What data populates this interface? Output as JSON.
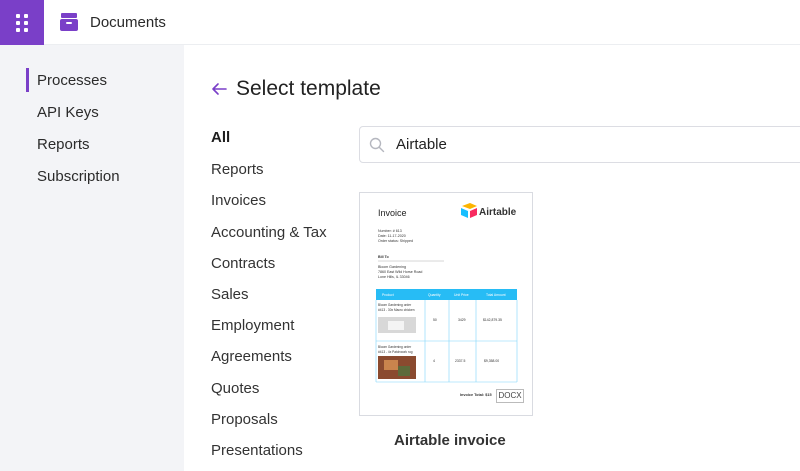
{
  "header": {
    "brand_title": "Documents",
    "launcher_icon": "app-launcher-icon",
    "brand_icon": "inbox-tray-icon",
    "accent_color": "#7a3fc8"
  },
  "sidebar": {
    "items": [
      {
        "label": "Processes",
        "active": true
      },
      {
        "label": "API Keys",
        "active": false
      },
      {
        "label": "Reports",
        "active": false
      },
      {
        "label": "Subscription",
        "active": false
      }
    ]
  },
  "main": {
    "title": "Select template",
    "back_icon": "arrow-left-icon",
    "categories": [
      {
        "label": "All",
        "active": true
      },
      {
        "label": "Reports"
      },
      {
        "label": "Invoices"
      },
      {
        "label": "Accounting & Tax"
      },
      {
        "label": "Contracts"
      },
      {
        "label": "Sales"
      },
      {
        "label": "Employment"
      },
      {
        "label": "Agreements"
      },
      {
        "label": "Quotes"
      },
      {
        "label": "Proposals"
      },
      {
        "label": "Presentations"
      }
    ],
    "search": {
      "value": "Airtable",
      "icon": "search-icon"
    },
    "templates": [
      {
        "label": "Airtable invoice",
        "format": "DOCX",
        "preview": {
          "heading": "Invoice",
          "logo_text": "Airtable",
          "meta": [
            "Number: # 613",
            "Date: 11-17-2020",
            "Order status: Shipped"
          ],
          "bill_to_label": "Bill To",
          "bill_to": [
            "Bloom Gardening",
            "7860 East Wild Horse Road",
            "Lone Hills, IL 33046"
          ],
          "columns": [
            "Product",
            "Quantity",
            "Unit Price",
            "Total Amount"
          ],
          "rows": [
            {
              "product": [
                "Bloom   Gardening   order",
                "#413 - 30x Macro chicken"
              ],
              "qty": "50",
              "price": "3429",
              "total": "$142,879.35"
            },
            {
              "product": [
                "Bloom   Gardening   order",
                "#413 - 4x Patchwork rug"
              ],
              "qty": "4",
              "price": "2337.5",
              "total": "$9,358.00"
            }
          ],
          "total_label": "Invoice Total: $15"
        }
      }
    ]
  }
}
